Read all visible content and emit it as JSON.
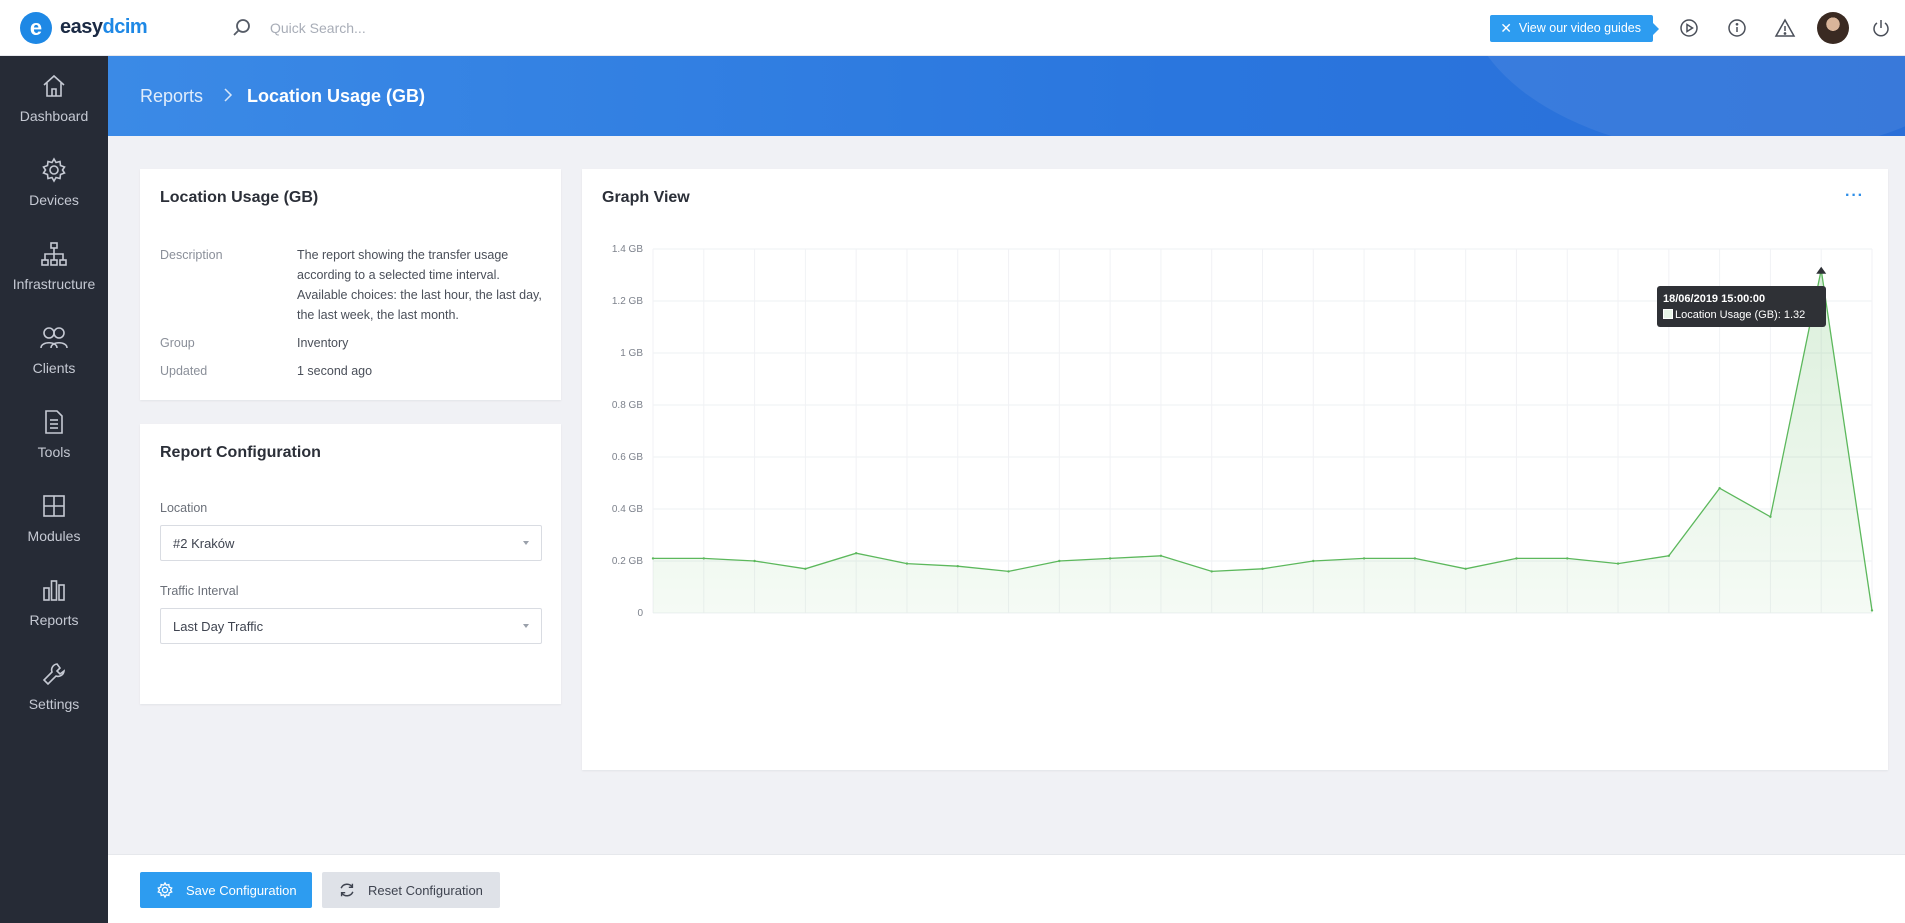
{
  "brand": {
    "name_left": "easy",
    "name_right": "dcim",
    "mark": "e",
    "accent": "#1e88e5"
  },
  "search": {
    "placeholder": "Quick Search..."
  },
  "topbar": {
    "video_guides_label": "View our video guides",
    "icons": [
      "play-circle-icon",
      "info-icon",
      "warning-icon",
      "avatar",
      "power-icon"
    ]
  },
  "sidebar": {
    "items": [
      {
        "label": "Dashboard",
        "icon": "home-icon"
      },
      {
        "label": "Devices",
        "icon": "gear-icon"
      },
      {
        "label": "Infrastructure",
        "icon": "sitemap-icon"
      },
      {
        "label": "Clients",
        "icon": "users-icon"
      },
      {
        "label": "Tools",
        "icon": "document-icon"
      },
      {
        "label": "Modules",
        "icon": "grid-icon"
      },
      {
        "label": "Reports",
        "icon": "bar-chart-icon"
      },
      {
        "label": "Settings",
        "icon": "wrench-icon"
      }
    ]
  },
  "breadcrumb": {
    "parent": "Reports",
    "current": "Location Usage (GB)"
  },
  "info": {
    "title": "Location Usage (GB)",
    "rows": [
      {
        "label": "Description",
        "value": "The report showing the transfer usage according to a selected time interval. Available choices: the last hour, the last day, the last week, the last month."
      },
      {
        "label": "Group",
        "value": "Inventory"
      },
      {
        "label": "Updated",
        "value": "1 second ago"
      }
    ]
  },
  "config": {
    "title": "Report Configuration",
    "location_label": "Location",
    "location_value": "#2 Kraków",
    "interval_label": "Traffic Interval",
    "interval_value": "Last Day Traffic"
  },
  "graph": {
    "title": "Graph View",
    "more_label": "···",
    "tooltip": {
      "date": "18/06/2019 15:00:00",
      "text": "Location Usage (GB): 1.32"
    }
  },
  "chart_data": {
    "type": "area",
    "title": "Graph View",
    "ylim": [
      0,
      1.4
    ],
    "yticks": [
      "0",
      "0.2 GB",
      "0.4 GB",
      "0.6 GB",
      "0.8 GB",
      "1 GB",
      "1.2 GB",
      "1.4 GB"
    ],
    "grid": true,
    "color": "#5cb85c",
    "series": [
      {
        "name": "Location Usage (GB)",
        "values": [
          0.21,
          0.21,
          0.2,
          0.17,
          0.23,
          0.19,
          0.18,
          0.16,
          0.2,
          0.21,
          0.22,
          0.16,
          0.17,
          0.2,
          0.21,
          0.21,
          0.17,
          0.21,
          0.21,
          0.19,
          0.22,
          0.48,
          0.37,
          1.32,
          0.01
        ]
      }
    ]
  },
  "footer": {
    "save_label": "Save Configuration",
    "reset_label": "Reset Configuration"
  }
}
